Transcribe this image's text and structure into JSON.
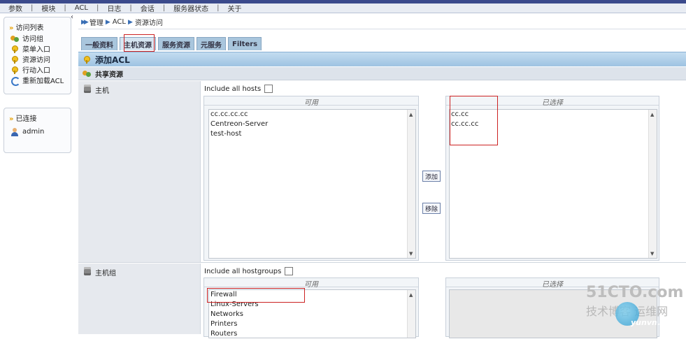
{
  "menu": [
    "参数",
    "模块",
    "ACL",
    "日志",
    "会话",
    "服务器状态",
    "关于"
  ],
  "sidebar": {
    "access_list": {
      "title": "访问列表",
      "items": [
        {
          "label": "访问组",
          "icon": "user-group-icon"
        },
        {
          "label": "菜单入口",
          "icon": "key-icon"
        },
        {
          "label": "资源访问",
          "icon": "key-icon"
        },
        {
          "label": "行动入口",
          "icon": "key-icon"
        },
        {
          "label": "重新加载ACL",
          "icon": "reload-icon"
        }
      ]
    },
    "connected": {
      "title": "已连接",
      "user": "admin"
    }
  },
  "breadcrumb": [
    "管理",
    "ACL",
    "资源访问"
  ],
  "tabs": [
    "一般资料",
    "主机资源",
    "服务资源",
    "元服务",
    "Filters"
  ],
  "form": {
    "title": "添加ACL",
    "section": "共享资源",
    "hosts": {
      "label": "主机",
      "include_label": "Include all hosts",
      "available_header": "可用",
      "selected_header": "已选择",
      "available": [
        "cc.cc.cc.cc",
        "Centreon-Server",
        "test-host"
      ],
      "selected": [
        "cc.cc",
        "cc.cc.cc"
      ],
      "add_label": "添加",
      "remove_label": "移除"
    },
    "hostgroups": {
      "label": "主机组",
      "include_label": "Include all hostgroups",
      "available_header": "可用",
      "selected_header": "已选择",
      "available": [
        "Firewall",
        "Linux-Servers",
        "Networks",
        "Printers",
        "Routers"
      ]
    }
  },
  "watermark": {
    "site": "51CTO.com",
    "tagline": "技术博客",
    "brand": "运维网",
    "url": "yunvn.com"
  }
}
